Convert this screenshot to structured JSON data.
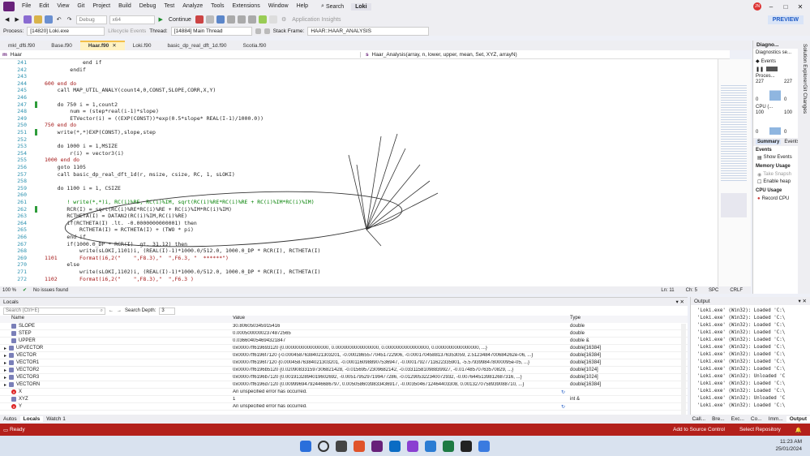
{
  "menu": {
    "items": [
      "File",
      "Edit",
      "View",
      "Git",
      "Project",
      "Build",
      "Debug",
      "Test",
      "Analyze",
      "Tools",
      "Extensions",
      "Window",
      "Help"
    ],
    "search": "Search",
    "solution": "Loki",
    "avatar": "JN"
  },
  "toolbar": {
    "config": "Debug",
    "platform": "x64",
    "continue_label": "Continue",
    "app_insights": "Application Insights",
    "preview": "PREVIEW",
    "process_label": "Process:",
    "process_value": "[14820] Loki.exe",
    "lifecycle": "Lifecycle Events",
    "thread_label": "Thread:",
    "thread_value": "[14884] Main Thread",
    "stack_label": "Stack Frame:",
    "stack_value": "HAAR::HAAR_ANALYSIS"
  },
  "tabs": [
    "mkl_dfti.f90",
    "Base.f90",
    "Haar.f90",
    "Loki.f90",
    "basic_dp_real_dft_1d.f90",
    "Scotia.f90"
  ],
  "active_tab": "Haar.f90",
  "navbar": {
    "scope": "Haar",
    "function": "Haar_Analysis(array, n, lower, upper, mean, Set, XYZ, arrayN)"
  },
  "code": [
    {
      "n": "241",
      "text": "            end if"
    },
    {
      "n": "242",
      "text": "        endif"
    },
    {
      "n": "243",
      "text": ""
    },
    {
      "n": "244",
      "text": "600 end do"
    },
    {
      "n": "245",
      "text": "    call MAP_UTIL_ANALY(count4,0,CONST,SLOPE,CORR,X,Y)"
    },
    {
      "n": "246",
      "text": ""
    },
    {
      "n": "247",
      "text": "    do 750 i = 1,count2"
    },
    {
      "n": "248",
      "text": "        num = (step*real(i-1)*slope)"
    },
    {
      "n": "249",
      "text": "        ETVector(i) = ((EXP(CONST))*exp(0.5*slope* REAL(I-1)/1000.0))"
    },
    {
      "n": "250",
      "text": "750 end do"
    },
    {
      "n": "251",
      "text": "    write(*,*)EXP(CONST),slope,step"
    },
    {
      "n": "252",
      "text": ""
    },
    {
      "n": "253",
      "text": "    do 1000 i = 1,MSIZE"
    },
    {
      "n": "254",
      "text": "        r(i) = vector3(i)"
    },
    {
      "n": "255",
      "text": "1000 end do"
    },
    {
      "n": "256",
      "text": "    goto 1105"
    },
    {
      "n": "257",
      "text": "    call basic_dp_real_dft_1d(r, msize, csize, RC, 1, sLOKI)"
    },
    {
      "n": "258",
      "text": ""
    },
    {
      "n": "259",
      "text": "    do 1100 i = 1, CSIZE"
    },
    {
      "n": "260",
      "text": ""
    },
    {
      "n": "261",
      "text": "       ! write(*,*)i, RC(i)%RE, RC(i)%IM, sqrt(RC(i)%RE*RC(i)%RE + RC(i)%IM*RC(i)%IM)"
    },
    {
      "n": "262",
      "text": "       RCR(I) = sqrt(RC(i)%RE*RC(i)%RE + RC(i)%IM*RC(i)%IM)"
    },
    {
      "n": "263",
      "text": "       RCTHETA(I) = DATAN2(RC(i)%IM,RC(i)%RE)"
    },
    {
      "n": "264",
      "text": "       if(RCTHETA(I) .lt. -0.0000000000001) then"
    },
    {
      "n": "265",
      "text": "           RCTHETA(I) = RCTHETA(I) + (TWO * pi)"
    },
    {
      "n": "266",
      "text": "       end if"
    },
    {
      "n": "267",
      "text": "       if(1000.0_DP * RCR(I) .gt. 31.12) then"
    },
    {
      "n": "268",
      "text": "           write(sLOKI,1101)i, (REAL(I)-1)*1000.0/512.0, 1000.0_DP * RCR(I), RCTHETA(I)"
    },
    {
      "n": "269",
      "text": "1101       Format(i6,2(\"    \",F8.3),\"  \",F6.3, \"  ******\")"
    },
    {
      "n": "270",
      "text": "       else"
    },
    {
      "n": "271",
      "text": "           write(sLOKI,1102)i, (REAL(I)-1)*1000.0/512.0, 1000.0_DP * RCR(I), RCTHETA(I)"
    },
    {
      "n": "272",
      "text": "1102       Format(i6,2(\"    \",F8.3),\"  \",F6.3 )"
    }
  ],
  "editor_status": {
    "zoom": "100 %",
    "issues": "No issues found",
    "ln": "Ln: 11",
    "ch": "Ch: 5",
    "ws": "SPC",
    "eol": "CRLF"
  },
  "diag": {
    "title": "Diagno...",
    "sub": "Diagnostics se...",
    "events": "Events",
    "process": "Proces...",
    "v1": "227",
    "v2": "227",
    "z1": "0",
    "z2": "0",
    "cpu": "CPU (...",
    "c1": "100",
    "c2": "100",
    "c3": "0",
    "c4": "0",
    "summary": "Summary",
    "events_tab": "Events",
    "events2": "Events",
    "show_events": "Show Events",
    "memory": "Memory Usage",
    "take_snapshot": "Take Snapsh",
    "enable_heap": "Enable heap",
    "cpu_usage": "CPU Usage",
    "record_cpu": "Record CPU"
  },
  "side_tabs": [
    "Solution Explorer",
    "Git Changes"
  ],
  "locals": {
    "title": "Locals",
    "search_placeholder": "Search (Ctrl+E)",
    "depth_label": "Search Depth:",
    "depth_value": "3",
    "col_name": "Name",
    "col_value": "Value",
    "col_type": "Type",
    "rows": [
      {
        "name": "SLOPE",
        "value": "30.806050345915416",
        "type": "double",
        "err": false
      },
      {
        "name": "STEP",
        "value": "0.00050000002374872565",
        "type": "double",
        "err": false
      },
      {
        "name": "UPPER",
        "value": "0.036604054694321847",
        "type": "double &",
        "err": false
      },
      {
        "name": "UPVECTOR",
        "value": "0x00007ff619693120 {0.0000000000000000, 0.0000000000000000, 0.0000000000000000, 0.0000000000000000, ...}",
        "type": "double[16384]",
        "err": false
      },
      {
        "name": "VECTOR",
        "value": "0x00007ff6196f7120 {-0.00045876384021303201, -0.00028655770451722906, -0.00017045881376353059, 2.5123484700684262e-06, ...}",
        "type": "double[16384]",
        "err": false
      },
      {
        "name": "VECTOR1",
        "value": "0x00007ff6196f7120 {0.00045876384021303201, -0.0001160988907536947, -0.00017927711622335901, -5.5793998478000095e-05, ...}",
        "type": "double[16384]",
        "err": false
      },
      {
        "name": "VECTOR2",
        "value": "0x00007ff6196b5120 {0.020908331597306821428, -0.01569572309682142, -0.03311581098839927, -0.01748570763570829, ...}",
        "type": "double[1024]",
        "err": false
      },
      {
        "name": "VECTOR3",
        "value": "0x00007ff6196b7120 {0.0019132894019602692, -0.0051795297199477286, -0.012905322340072932, -0.0076445139812687316, ...}",
        "type": "double[1024]",
        "err": false
      },
      {
        "name": "VECTORN",
        "value": "0x00007ff6196d7120 {0.00999694792446686797, 0.0050586039833436917, -0.0035046712464403308, 0.0013270758939088710, ...}",
        "type": "double[16384]",
        "err": false
      },
      {
        "name": "X",
        "value": "An unspecified error has occurred.",
        "type": "",
        "err": true
      },
      {
        "name": "XYZ",
        "value": "1",
        "type": "int &",
        "err": false
      },
      {
        "name": "Y",
        "value": "An unspecified error has occurred.",
        "type": "",
        "err": true
      }
    ]
  },
  "output": {
    "title": "Output",
    "lines": [
      "'Loki.exe' (Win32): Loaded 'C:\\",
      "'Loki.exe' (Win32): Loaded 'C:\\",
      "'Loki.exe' (Win32): Loaded 'C:\\",
      "'Loki.exe' (Win32): Loaded 'C:\\",
      "'Loki.exe' (Win32): Loaded 'C:\\",
      "'Loki.exe' (Win32): Loaded 'C:\\",
      "'Loki.exe' (Win32): Loaded 'C:\\",
      "'Loki.exe' (Win32): Loaded 'C:\\",
      "'Loki.exe' (Win32): Loaded 'C:\\",
      "'Loki.exe' (Win32): Unloaded 'C",
      "'Loki.exe' (Win32): Loaded 'C:\\",
      "'Loki.exe' (Win32): Loaded 'C:\\",
      "'Loki.exe' (Win32): Unloaded 'C",
      "'Loki.exe' (Win32): Loaded 'C:\\"
    ]
  },
  "bottom_tabs": [
    "Autos",
    "Locals",
    "Watch 1"
  ],
  "bottom_tabs_right": [
    "Call...",
    "Bre...",
    "Exc...",
    "Co...",
    "Imm...",
    "Output"
  ],
  "status": {
    "ready": "Ready",
    "source_control": "Add to Source Control",
    "repo": "Select Repository"
  },
  "taskbar": {
    "time": "11:23 AM",
    "date": "25/01/2024"
  },
  "colors": {
    "status_bar": "#b3201b",
    "active_tab": "#fff2c2",
    "keyword": "#0000ff",
    "label": "#a31515"
  }
}
